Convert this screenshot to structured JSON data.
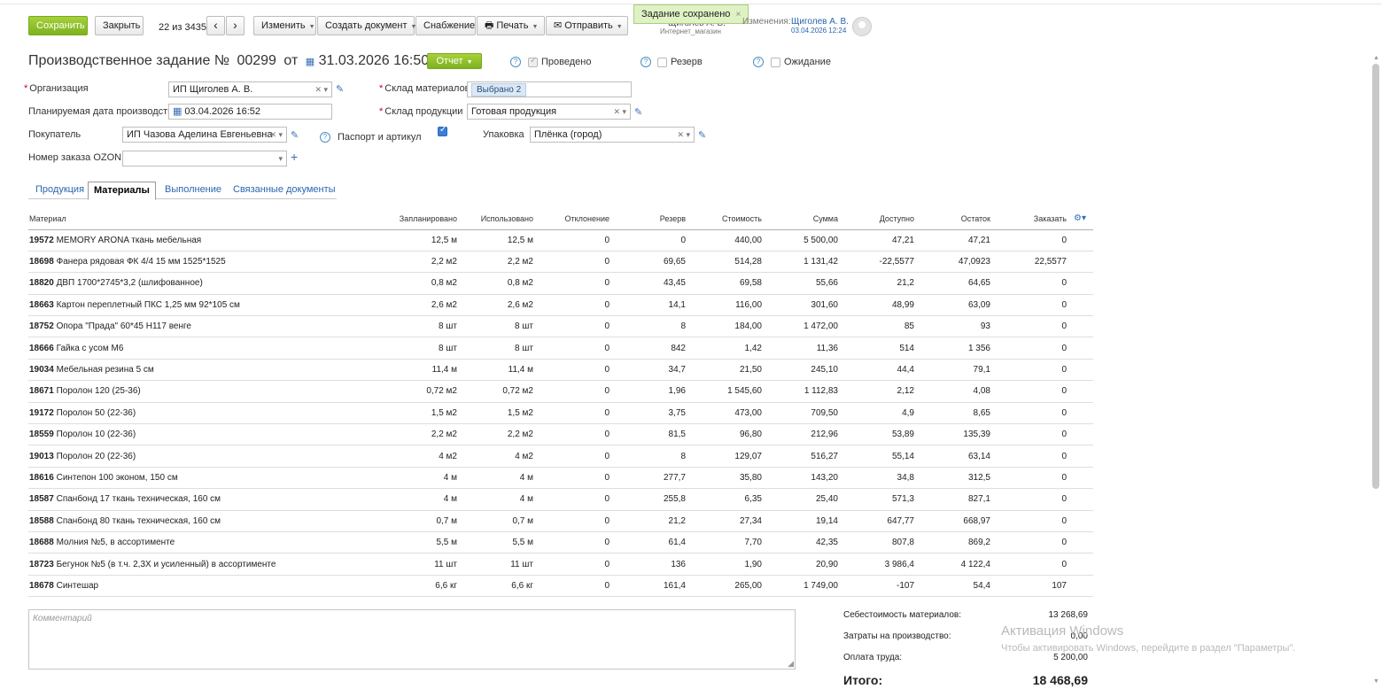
{
  "toolbar": {
    "save": "Сохранить",
    "close": "Закрыть",
    "counter": "22 из 3435",
    "prev": "‹",
    "next": "›",
    "edit": "Изменить",
    "create_doc": "Создать документ",
    "supply": "Снабжение",
    "print": "Печать",
    "send": "Отправить"
  },
  "toast": {
    "text": "Задание сохранено",
    "close": "×"
  },
  "author": {
    "name_hidden": "Щиголев А. В.",
    "store": "Интернет_магазин",
    "changes_label": "Изменения:",
    "changes_user": "Щиголев А. В.",
    "changes_date": "03.04.2026 12:24"
  },
  "header": {
    "title_prefix": "Производственное задание №",
    "number": "00299",
    "from": "от",
    "date": "31.03.2026 16:50",
    "report_button": "Отчет",
    "posted_label": "Проведено",
    "reserve_label": "Резерв",
    "waiting_label": "Ожидание"
  },
  "form": {
    "org_label": "Организация",
    "org_value": "ИП Щиголев А. В.",
    "materials_wh_label": "Склад материалов",
    "materials_wh_value": "Выбрано 2",
    "plan_date_label": "Планируемая дата производства",
    "plan_date_value": "03.04.2026 16:52",
    "product_wh_label": "Склад продукции",
    "product_wh_value": "Готовая продукция",
    "buyer_label": "Покупатель",
    "buyer_value": "ИП Чазова Аделина Евгеньевна",
    "passport_label": "Паспорт и артикул",
    "packing_label": "Упаковка",
    "packing_value": "Плёнка (город)",
    "ozon_label": "Номер заказа OZON",
    "ozon_value": ""
  },
  "tabs": [
    "Продукция",
    "Материалы",
    "Выполнение",
    "Связанные документы"
  ],
  "table": {
    "columns": [
      "Материал",
      "Запланировано",
      "Использовано",
      "Отклонение",
      "Резерв",
      "Стоимость",
      "Сумма",
      "Доступно",
      "Остаток",
      "Заказать"
    ],
    "rows": [
      {
        "code": "19572",
        "name": "MEMORY ARONA ткань мебельная",
        "plan": "12,5 м",
        "used": "12,5 м",
        "dev": "0",
        "res": "0",
        "cost": "440,00",
        "sum": "5 500,00",
        "avail": "47,21",
        "rest": "47,21",
        "order": "0"
      },
      {
        "code": "18698",
        "name": "Фанера рядовая ФК 4/4 15 мм 1525*1525",
        "plan": "2,2 м2",
        "used": "2,2 м2",
        "dev": "0",
        "res": "69,65",
        "cost": "514,28",
        "sum": "1 131,42",
        "avail": "-22,5577",
        "rest": "47,0923",
        "order": "22,5577"
      },
      {
        "code": "18820",
        "name": "ДВП 1700*2745*3,2 (шлифованное)",
        "plan": "0,8 м2",
        "used": "0,8 м2",
        "dev": "0",
        "res": "43,45",
        "cost": "69,58",
        "sum": "55,66",
        "avail": "21,2",
        "rest": "64,65",
        "order": "0"
      },
      {
        "code": "18663",
        "name": "Картон переплетный ПКС 1,25 мм 92*105 см",
        "plan": "2,6 м2",
        "used": "2,6 м2",
        "dev": "0",
        "res": "14,1",
        "cost": "116,00",
        "sum": "301,60",
        "avail": "48,99",
        "rest": "63,09",
        "order": "0"
      },
      {
        "code": "18752",
        "name": "Опора \"Прада\" 60*45 Н117 венге",
        "plan": "8 шт",
        "used": "8 шт",
        "dev": "0",
        "res": "8",
        "cost": "184,00",
        "sum": "1 472,00",
        "avail": "85",
        "rest": "93",
        "order": "0"
      },
      {
        "code": "18666",
        "name": "Гайка с усом М6",
        "plan": "8 шт",
        "used": "8 шт",
        "dev": "0",
        "res": "842",
        "cost": "1,42",
        "sum": "11,36",
        "avail": "514",
        "rest": "1 356",
        "order": "0"
      },
      {
        "code": "19034",
        "name": "Мебельная резина 5 см",
        "plan": "11,4 м",
        "used": "11,4 м",
        "dev": "0",
        "res": "34,7",
        "cost": "21,50",
        "sum": "245,10",
        "avail": "44,4",
        "rest": "79,1",
        "order": "0"
      },
      {
        "code": "18671",
        "name": "Поролон 120 (25-36)",
        "plan": "0,72 м2",
        "used": "0,72 м2",
        "dev": "0",
        "res": "1,96",
        "cost": "1 545,60",
        "sum": "1 112,83",
        "avail": "2,12",
        "rest": "4,08",
        "order": "0"
      },
      {
        "code": "19172",
        "name": "Поролон 50 (22-36)",
        "plan": "1,5 м2",
        "used": "1,5 м2",
        "dev": "0",
        "res": "3,75",
        "cost": "473,00",
        "sum": "709,50",
        "avail": "4,9",
        "rest": "8,65",
        "order": "0"
      },
      {
        "code": "18559",
        "name": "Поролон 10 (22-36)",
        "plan": "2,2 м2",
        "used": "2,2 м2",
        "dev": "0",
        "res": "81,5",
        "cost": "96,80",
        "sum": "212,96",
        "avail": "53,89",
        "rest": "135,39",
        "order": "0"
      },
      {
        "code": "19013",
        "name": "Поролон 20 (22-36)",
        "plan": "4 м2",
        "used": "4 м2",
        "dev": "0",
        "res": "8",
        "cost": "129,07",
        "sum": "516,27",
        "avail": "55,14",
        "rest": "63,14",
        "order": "0"
      },
      {
        "code": "18616",
        "name": "Синтепон 100 эконом, 150 см",
        "plan": "4 м",
        "used": "4 м",
        "dev": "0",
        "res": "277,7",
        "cost": "35,80",
        "sum": "143,20",
        "avail": "34,8",
        "rest": "312,5",
        "order": "0"
      },
      {
        "code": "18587",
        "name": "Спанбонд 17 ткань техническая, 160 см",
        "plan": "4 м",
        "used": "4 м",
        "dev": "0",
        "res": "255,8",
        "cost": "6,35",
        "sum": "25,40",
        "avail": "571,3",
        "rest": "827,1",
        "order": "0"
      },
      {
        "code": "18588",
        "name": "Спанбонд 80 ткань техническая, 160 см",
        "plan": "0,7 м",
        "used": "0,7 м",
        "dev": "0",
        "res": "21,2",
        "cost": "27,34",
        "sum": "19,14",
        "avail": "647,77",
        "rest": "668,97",
        "order": "0"
      },
      {
        "code": "18688",
        "name": "Молния №5, в ассортименте",
        "plan": "5,5 м",
        "used": "5,5 м",
        "dev": "0",
        "res": "61,4",
        "cost": "7,70",
        "sum": "42,35",
        "avail": "807,8",
        "rest": "869,2",
        "order": "0"
      },
      {
        "code": "18723",
        "name": "Бегунок №5 (в т.ч. 2,3Х и усиленный) в ассортименте",
        "plan": "11 шт",
        "used": "11 шт",
        "dev": "0",
        "res": "136",
        "cost": "1,90",
        "sum": "20,90",
        "avail": "3 986,4",
        "rest": "4 122,4",
        "order": "0"
      },
      {
        "code": "18678",
        "name": "Синтешар",
        "plan": "6,6 кг",
        "used": "6,6 кг",
        "dev": "0",
        "res": "161,4",
        "cost": "265,00",
        "sum": "1 749,00",
        "avail": "-107",
        "rest": "54,4",
        "order": "107"
      }
    ]
  },
  "comment": {
    "placeholder": "Комментарий"
  },
  "summary": {
    "materials_cost_label": "Себестоимость материалов:",
    "materials_cost_value": "13 268,69",
    "production_costs_label": "Затраты на производство:",
    "production_costs_value": "0,00",
    "labor_label": "Оплата труда:",
    "labor_value": "5 200,00",
    "total_label": "Итого:",
    "total_value": "18 468,69"
  },
  "watermark": {
    "line1": "Активация Windows",
    "line2": "Чтобы активировать Windows, перейдите в раздел \"Параметры\"."
  },
  "colors": {
    "accent_green": "#8cc02a",
    "link_blue": "#2a65b0"
  }
}
